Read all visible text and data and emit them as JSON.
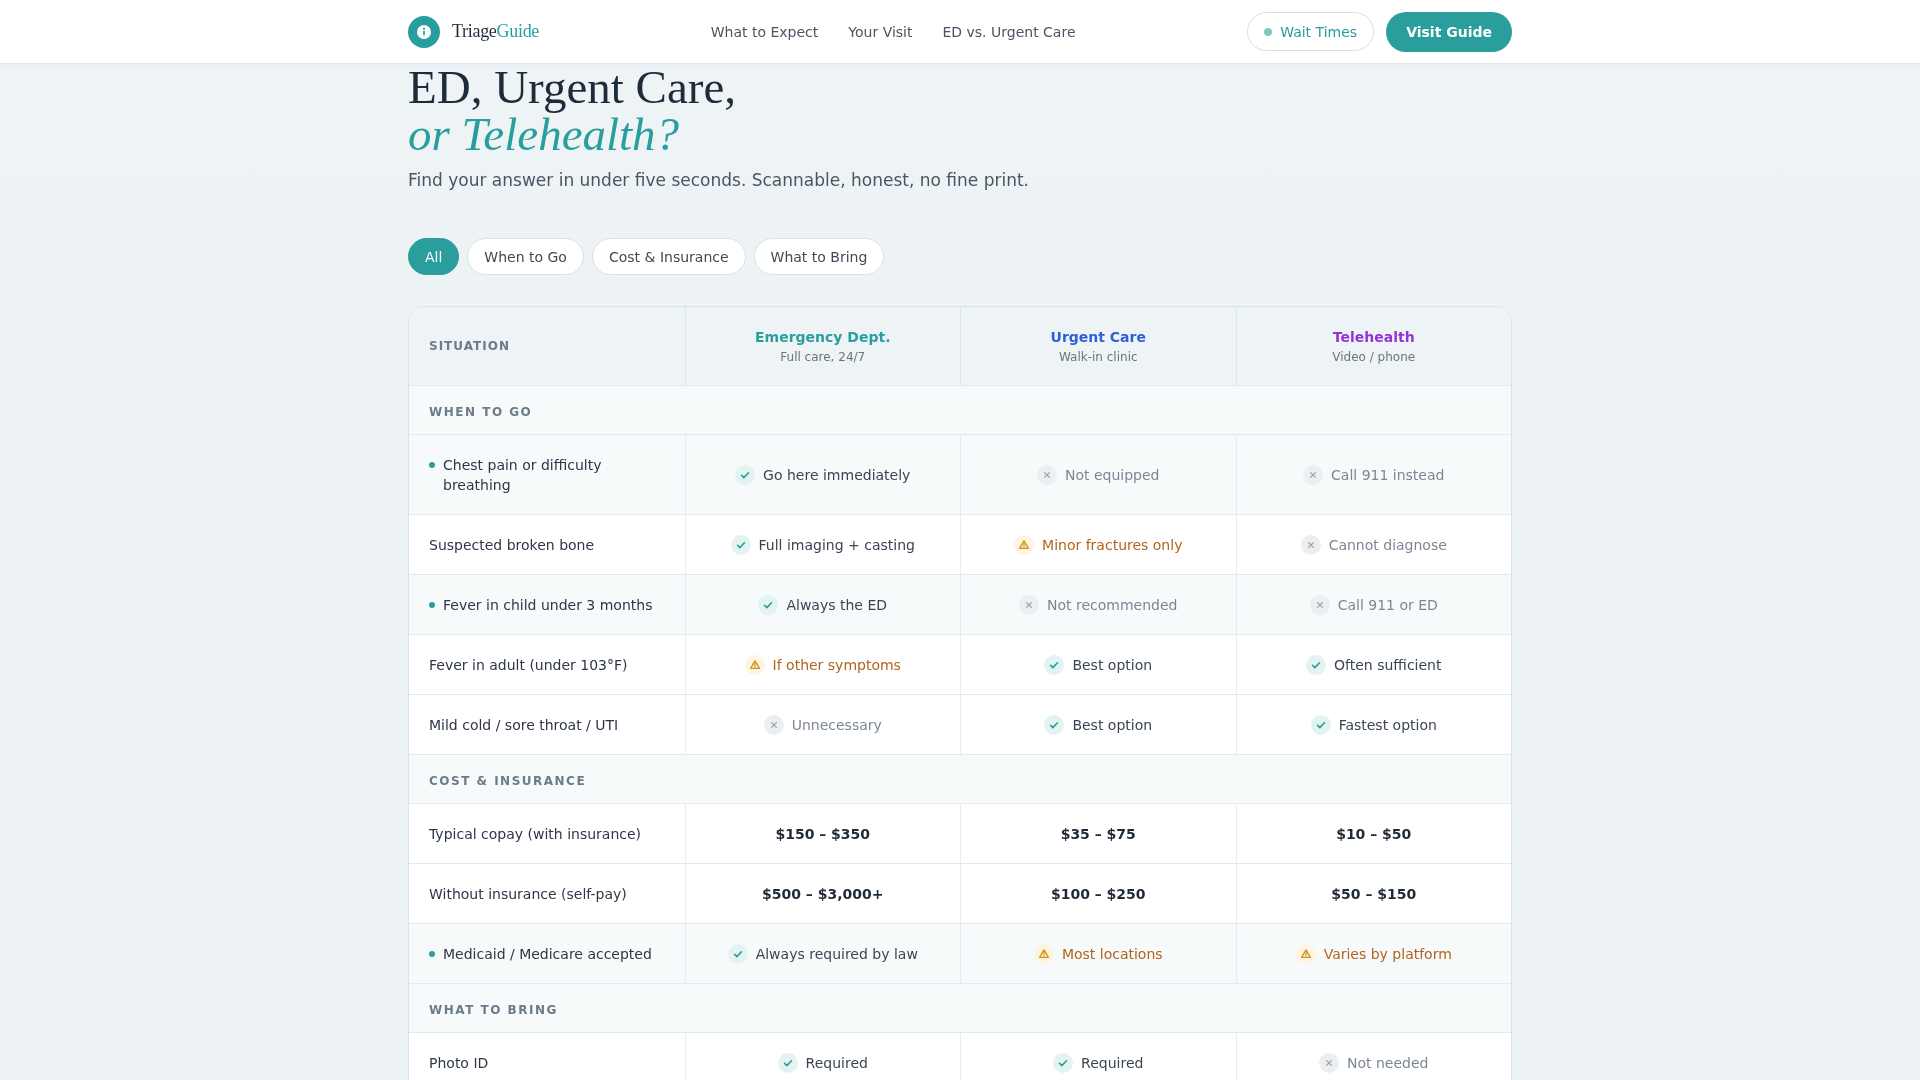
{
  "header": {
    "brand": {
      "name": "Triage",
      "accent": "Guide"
    },
    "nav": [
      "What to Expect",
      "Your Visit",
      "ED vs. Urgent Care"
    ],
    "status_link": "Wait Times",
    "cta": "Visit Guide"
  },
  "hero": {
    "title": "ED, Urgent Care,",
    "title_accent": "or Telehealth?",
    "subtitle": "Find your answer in under five seconds. Scannable, honest, no fine print."
  },
  "filters": [
    {
      "label": "All",
      "selected": true
    },
    {
      "label": "When to Go",
      "selected": false
    },
    {
      "label": "Cost & Insurance",
      "selected": false
    },
    {
      "label": "What to Bring",
      "selected": false
    }
  ],
  "table": {
    "situation_heading": "SITUATION",
    "columns": [
      {
        "name": "Emergency Dept.",
        "note": "Full care, 24/7",
        "color": "#2a9d9d"
      },
      {
        "name": "Urgent Care",
        "note": "Walk-in clinic",
        "color": "#2d5fd6"
      },
      {
        "name": "Telehealth",
        "note": "Video / phone",
        "color": "#9534d6"
      }
    ],
    "sections": [
      {
        "title": "WHEN TO GO",
        "rows": [
          {
            "situation": "Chest pain or difficulty breathing",
            "flagged": true,
            "cells": [
              {
                "kind": "yes",
                "text": "Go here immediately"
              },
              {
                "kind": "no",
                "text": "Not equipped"
              },
              {
                "kind": "no",
                "text": "Call 911 instead"
              }
            ]
          },
          {
            "situation": "Suspected broken bone",
            "flagged": false,
            "cells": [
              {
                "kind": "yes",
                "text": "Full imaging + casting"
              },
              {
                "kind": "partial",
                "text": "Minor fractures only"
              },
              {
                "kind": "no",
                "text": "Cannot diagnose"
              }
            ]
          },
          {
            "situation": "Fever in child under 3 months",
            "flagged": true,
            "cells": [
              {
                "kind": "yes",
                "text": "Always the ED"
              },
              {
                "kind": "no",
                "text": "Not recommended"
              },
              {
                "kind": "no",
                "text": "Call 911 or ED"
              }
            ]
          },
          {
            "situation": "Fever in adult (under 103°F)",
            "flagged": false,
            "cells": [
              {
                "kind": "partial",
                "text": "If other symptoms"
              },
              {
                "kind": "yes",
                "text": "Best option"
              },
              {
                "kind": "yes",
                "text": "Often sufficient"
              }
            ]
          },
          {
            "situation": "Mild cold / sore throat / UTI",
            "flagged": false,
            "cells": [
              {
                "kind": "no",
                "text": "Unnecessary"
              },
              {
                "kind": "yes",
                "text": "Best option"
              },
              {
                "kind": "yes",
                "text": "Fastest option"
              }
            ]
          }
        ]
      },
      {
        "title": "COST & INSURANCE",
        "rows": [
          {
            "situation": "Typical copay (with insurance)",
            "flagged": false,
            "cells": [
              {
                "kind": "price",
                "text": "$150 – $350"
              },
              {
                "kind": "price",
                "text": "$35 – $75"
              },
              {
                "kind": "price",
                "text": "$10 – $50"
              }
            ]
          },
          {
            "situation": "Without insurance (self-pay)",
            "flagged": false,
            "cells": [
              {
                "kind": "price",
                "text": "$500 – $3,000+"
              },
              {
                "kind": "price",
                "text": "$100 – $250"
              },
              {
                "kind": "price",
                "text": "$50 – $150"
              }
            ]
          },
          {
            "situation": "Medicaid / Medicare accepted",
            "flagged": true,
            "cells": [
              {
                "kind": "yes",
                "text": "Always required by law"
              },
              {
                "kind": "partial",
                "text": "Most locations"
              },
              {
                "kind": "partial",
                "text": "Varies by platform"
              }
            ]
          }
        ]
      },
      {
        "title": "WHAT TO BRING",
        "rows": [
          {
            "situation": "Photo ID",
            "flagged": false,
            "cells": [
              {
                "kind": "yes",
                "text": "Required"
              },
              {
                "kind": "yes",
                "text": "Required"
              },
              {
                "kind": "no",
                "text": "Not needed"
              }
            ]
          }
        ]
      }
    ]
  }
}
